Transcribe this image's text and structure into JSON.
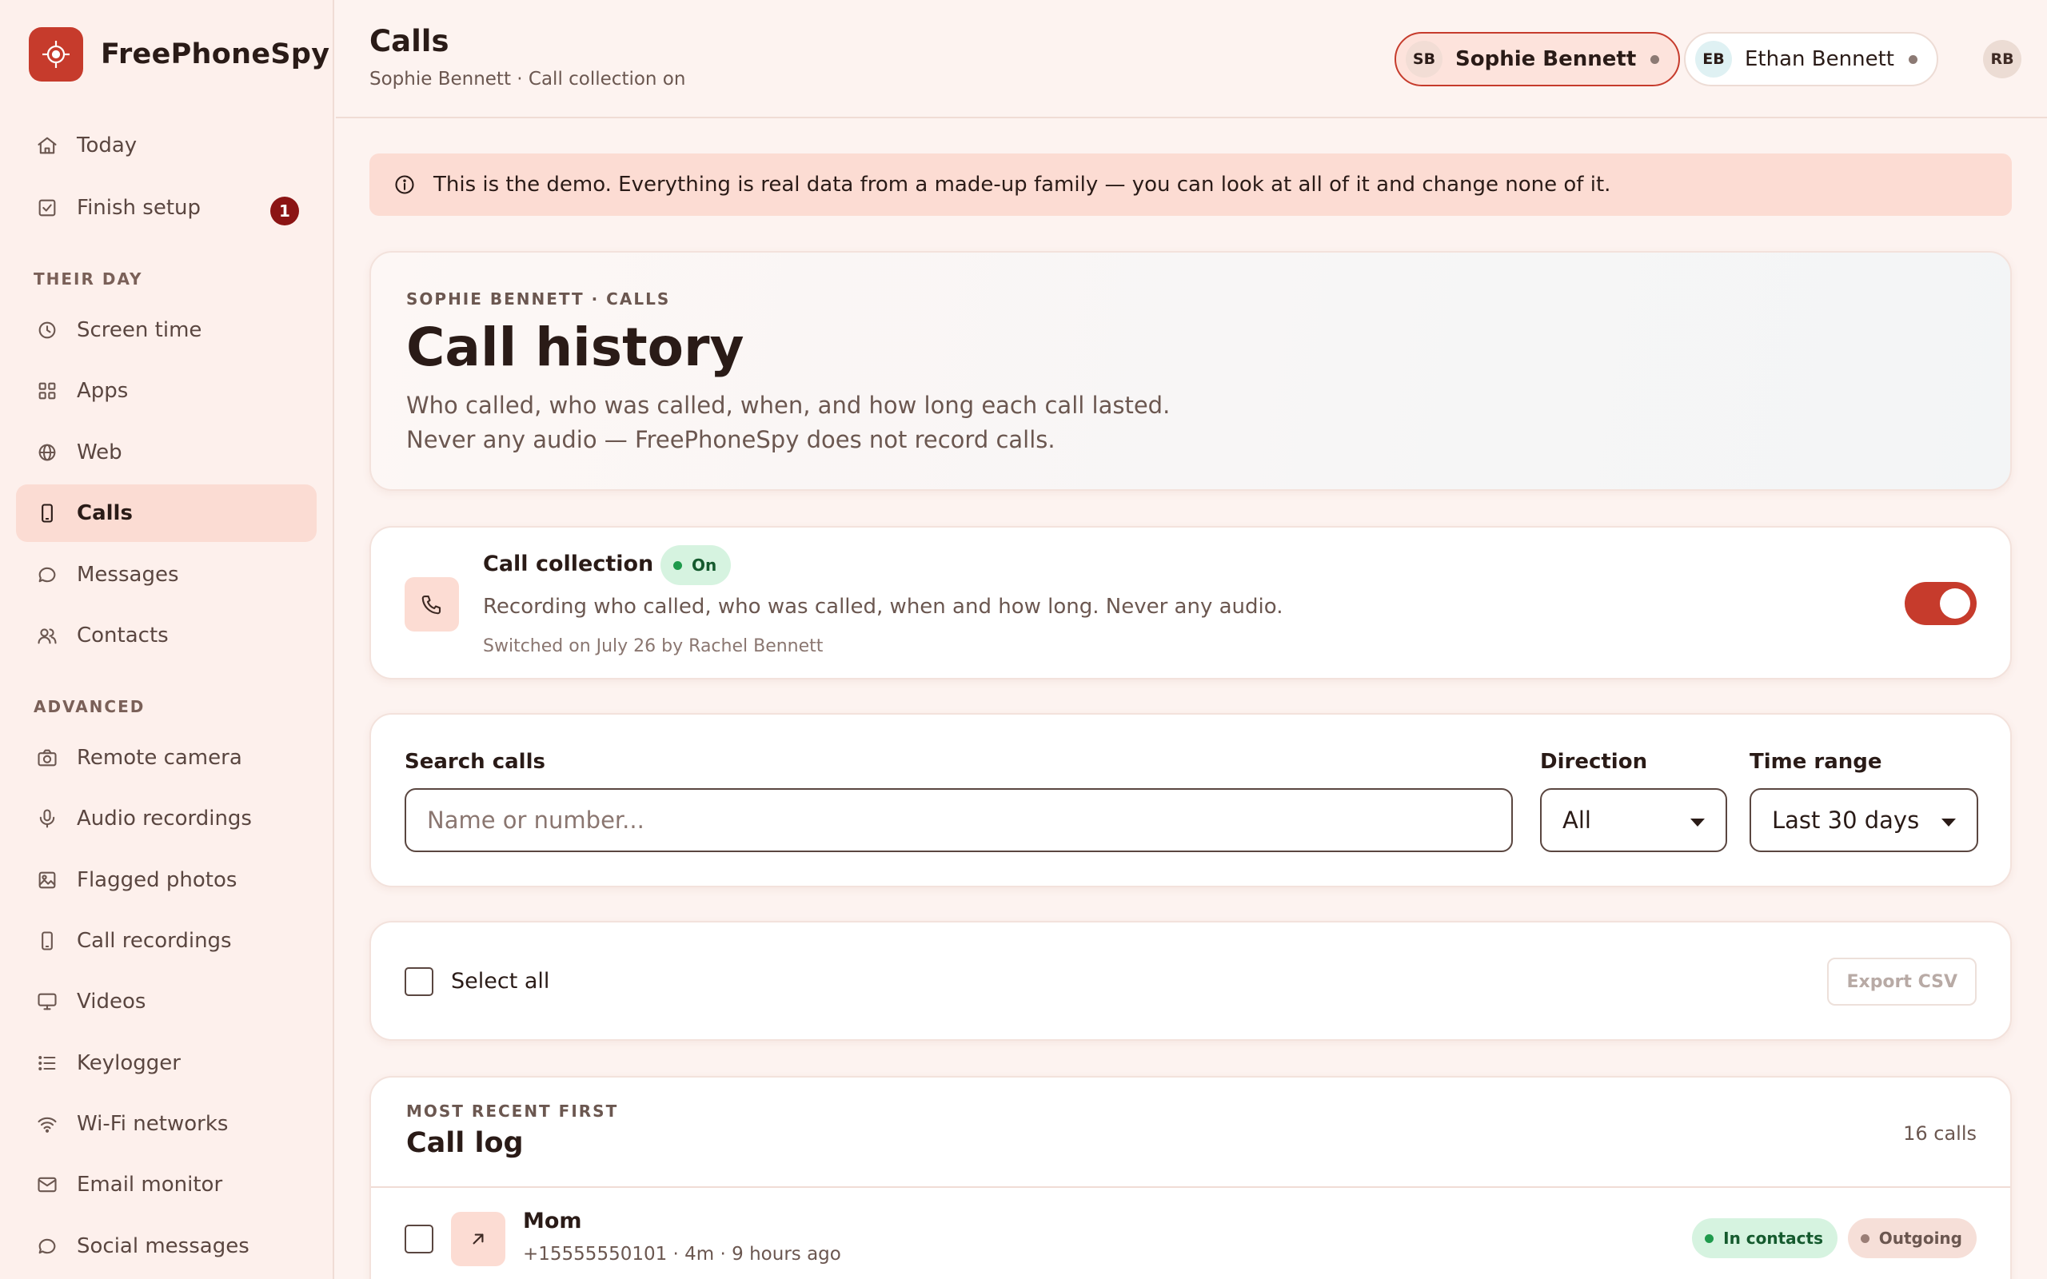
{
  "brand": {
    "name": "FreePhoneSpy",
    "logo_icon": "target-icon",
    "accent": "#c63b2c"
  },
  "sidebar": {
    "items_top": [
      {
        "label": "Today",
        "icon": "home-icon"
      },
      {
        "label": "Finish setup",
        "icon": "checkbox-icon",
        "badge": "1"
      }
    ],
    "section_their_day": "THEIR DAY",
    "items_their_day": [
      {
        "label": "Screen time",
        "icon": "clock-icon"
      },
      {
        "label": "Apps",
        "icon": "grid-icon"
      },
      {
        "label": "Web",
        "icon": "globe-icon"
      },
      {
        "label": "Calls",
        "icon": "phone-device-icon",
        "active": true
      },
      {
        "label": "Messages",
        "icon": "chat-bubble-icon"
      },
      {
        "label": "Contacts",
        "icon": "people-icon"
      }
    ],
    "section_advanced": "ADVANCED",
    "items_advanced": [
      {
        "label": "Remote camera",
        "icon": "camera-icon"
      },
      {
        "label": "Audio recordings",
        "icon": "microphone-icon"
      },
      {
        "label": "Flagged photos",
        "icon": "image-icon"
      },
      {
        "label": "Call recordings",
        "icon": "phone-device-icon"
      },
      {
        "label": "Videos",
        "icon": "monitor-icon"
      },
      {
        "label": "Keylogger",
        "icon": "list-icon"
      },
      {
        "label": "Wi-Fi networks",
        "icon": "wifi-icon"
      },
      {
        "label": "Email monitor",
        "icon": "mail-icon"
      },
      {
        "label": "Social messages",
        "icon": "chat-bubble-icon"
      }
    ]
  },
  "header": {
    "title": "Calls",
    "subtitle": "Sophie Bennett · Call collection on",
    "people": [
      {
        "initials": "SB",
        "name": "Sophie Bennett",
        "active": true,
        "avatar_color": "#f2ddd5"
      },
      {
        "initials": "EB",
        "name": "Ethan Bennett",
        "active": false,
        "avatar_color": "#dff1f3"
      }
    ],
    "user_initials": "RB"
  },
  "banner": {
    "text": "This is the demo. Everything is real data from a made-up family — you can look at all of it and change none of it.",
    "icon": "info-icon"
  },
  "hero": {
    "eyebrow": "SOPHIE BENNETT · CALLS",
    "title": "Call history",
    "description": "Who called, who was called, when, and how long each call lasted. Never any audio — FreePhoneSpy does not record calls."
  },
  "collection": {
    "title": "Call collection",
    "status": "On",
    "status_color": "#1f9a4c",
    "description": "Recording who called, who was called, when and how long. Never any audio.",
    "meta": "Switched on July 26 by Rachel Bennett",
    "enabled": true
  },
  "filters": {
    "search_label": "Search calls",
    "search_placeholder": "Name or number...",
    "search_value": "",
    "direction_label": "Direction",
    "direction_value": "All",
    "range_label": "Time range",
    "range_value": "Last 30 days"
  },
  "selection": {
    "select_all_label": "Select all",
    "export_label": "Export CSV"
  },
  "call_log": {
    "eyebrow": "MOST RECENT FIRST",
    "title": "Call log",
    "count": "16 calls",
    "rows": [
      {
        "name": "Mom",
        "meta": "+15555550101 · 4m · 9 hours ago",
        "direction_icon": "arrow-up-right-icon",
        "tags": [
          {
            "label": "In contacts",
            "color": "#1f9a4c",
            "bg": "#d6f3e0",
            "text": "#155a2e"
          },
          {
            "label": "Outgoing",
            "color": "#9a7e76",
            "bg": "#f6dfd8",
            "text": "#6b5750"
          }
        ]
      }
    ]
  }
}
